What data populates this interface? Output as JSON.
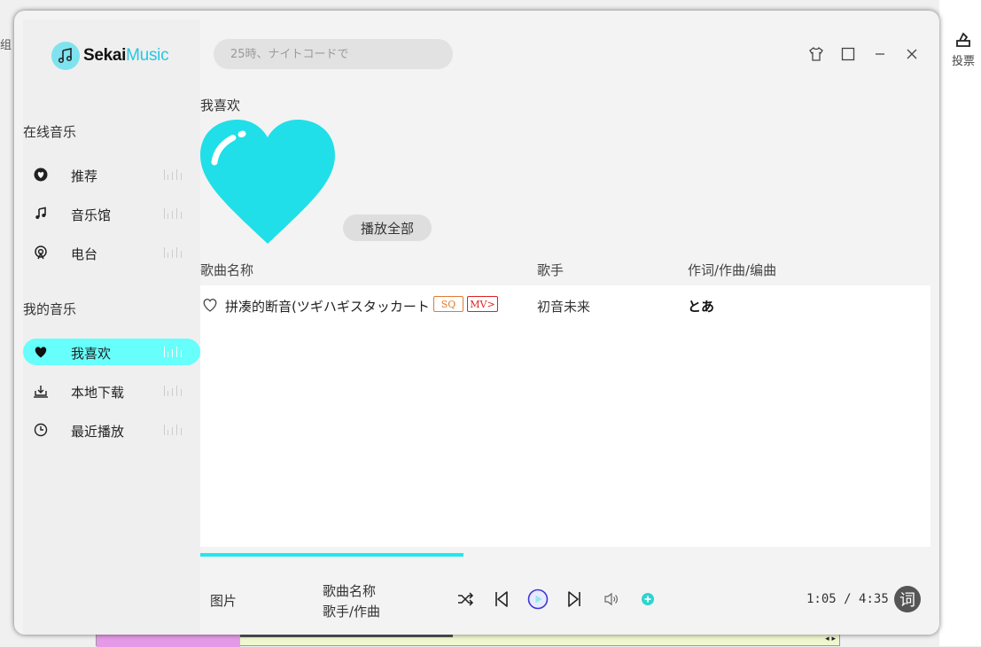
{
  "background": {
    "vote_label": "投票",
    "left_fragment": "组"
  },
  "app": {
    "logo_main": "Sekai",
    "logo_accent": "Music"
  },
  "colors": {
    "accent": "#66fffb",
    "cover_heart": "#20dfe8",
    "progress": "#20e8ee",
    "tag_sq": "#e27a2f",
    "tag_mv": "#dd2222"
  },
  "sidebar": {
    "online_title": "在线音乐",
    "online_items": [
      {
        "label": "推荐",
        "icon": "heart-circle-icon"
      },
      {
        "label": "音乐馆",
        "icon": "music-note-icon"
      },
      {
        "label": "电台",
        "icon": "radio-icon"
      }
    ],
    "my_title": "我的音乐",
    "my_items": [
      {
        "label": "我喜欢",
        "icon": "heart-icon",
        "active": true
      },
      {
        "label": "本地下载",
        "icon": "download-icon"
      },
      {
        "label": "最近播放",
        "icon": "clock-icon"
      }
    ]
  },
  "header": {
    "search_placeholder": "25時、ナイトコードで",
    "window_buttons": [
      "skin-icon",
      "maximize-icon",
      "minimize-icon",
      "close-icon"
    ]
  },
  "playlist": {
    "title": "我喜欢",
    "play_all_label": "播放全部",
    "columns": [
      "歌曲名称",
      "歌手",
      "作词/作曲/编曲"
    ],
    "songs": [
      {
        "name": "拼凑的断音(ツギハギスタッカート",
        "tags": [
          "SQ",
          "MV>"
        ],
        "artist": "初音未来",
        "lyricist": "とあ"
      }
    ]
  },
  "player": {
    "picture_label": "图片",
    "song_label": "歌曲名称",
    "artist_label": "歌手/作曲",
    "current_time": "1:05",
    "total_time": "4:35",
    "time_separator": "/",
    "lyrics_label": "词",
    "progress_fraction": 0.36
  }
}
